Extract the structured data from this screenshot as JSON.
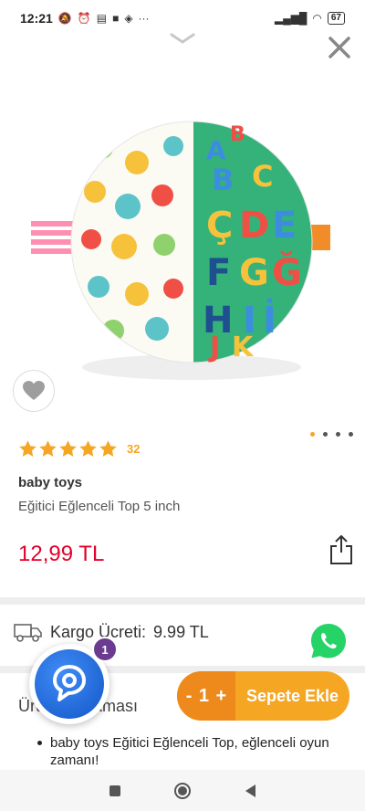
{
  "status_bar": {
    "time": "12:21",
    "left_icons": [
      "mute-icon",
      "alarm-icon",
      "news-icon",
      "app-icon",
      "drop-icon",
      "more-icon"
    ],
    "more": "···",
    "battery": "67"
  },
  "product": {
    "rating_count": "32",
    "brand": "baby toys",
    "name": "Eğitici Eğlenceli Top 5 inch",
    "price": "12,99 TL",
    "image_dots": 4,
    "active_dot": 0,
    "rating": 5
  },
  "cargo": {
    "label": "Kargo Ücreti:",
    "value": "9.99 TL"
  },
  "description": {
    "title": "Ürün Açıklaması",
    "items": [
      "baby toys Eğitici Eğlenceli Top, eğlenceli oyun zamanı!"
    ]
  },
  "chat": {
    "badge": "1"
  },
  "cart": {
    "minus": "-",
    "quantity": "1",
    "plus": "+",
    "add_label": "Sepete Ekle"
  },
  "colors": {
    "accent": "#f5a623",
    "price": "#e4002b",
    "whatsapp": "#25d366",
    "chat_blue": "#1f6fe0"
  }
}
